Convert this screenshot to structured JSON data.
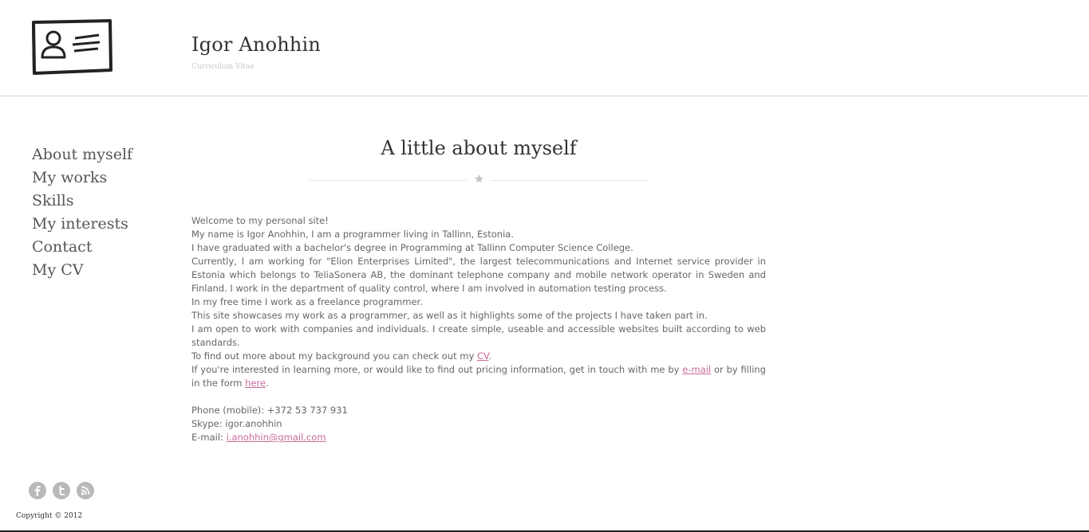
{
  "header": {
    "title": "Igor Anohhin",
    "subtitle": "Curriculum Vitae",
    "logo_icon": "id-card-icon"
  },
  "nav": {
    "items": [
      {
        "label": "About myself"
      },
      {
        "label": "My works"
      },
      {
        "label": "Skills"
      },
      {
        "label": "My interests"
      },
      {
        "label": "Contact"
      },
      {
        "label": "My CV"
      }
    ]
  },
  "main": {
    "heading": "A little about myself",
    "divider_icon": "star-icon",
    "paragraphs": {
      "p1": "Welcome to my personal site!",
      "p2": "My name is Igor Anohhin, I am a programmer living in Tallinn, Estonia.",
      "p3": "I have graduated with a bachelor's degree in Programming at Tallinn Computer Science College.",
      "p4": "Currently, I am working for \"Elion Enterprises Limited\", the largest telecommunications and Internet service provider in Estonia which belongs to TeliaSonera AB, the dominant telephone company and mobile network operator in Sweden and Finland. I work in the department of quality control, where I am involved in automation testing process.",
      "p5": "In my free time I work as a freelance programmer.",
      "p6": "This site showcases my work as a programmer, as well as it highlights some of the projects I have taken part in.",
      "p7": "I am open to work with companies and individuals. I create simple, useable and accessible websites built according to web standards.",
      "p8_before": "To find out more about my background you can check out my ",
      "p8_link": "CV",
      "p8_after": ".",
      "p9_before": "If you're interested in learning more, or would like to find out pricing information, get in touch with me by ",
      "p9_link1": "e-mail",
      "p9_middle": " or by filling in the form ",
      "p9_link2": "here",
      "p9_after": "."
    },
    "contact": {
      "phone": "Phone (mobile): +372 53 737 931",
      "skype": "Skype: igor.anohhin",
      "email_label": "E-mail: ",
      "email_value": "i.anohhin@gmail.com"
    }
  },
  "footer": {
    "social_icons": [
      "facebook-icon",
      "twitter-icon",
      "rss-icon"
    ],
    "copyright": "Copyright © 2012"
  },
  "colors": {
    "link": "#c86a99",
    "text": "#666666",
    "heading": "#333333",
    "icon_gray": "#b9b9b9"
  }
}
